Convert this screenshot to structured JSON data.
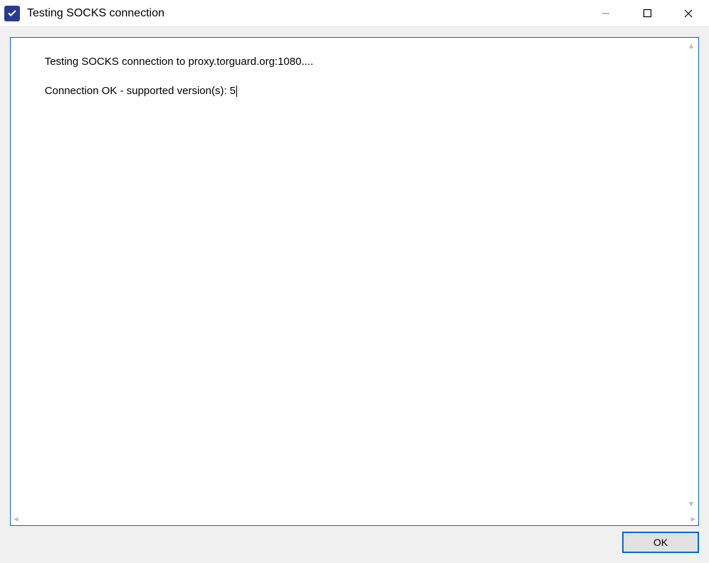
{
  "titlebar": {
    "title": "Testing SOCKS connection"
  },
  "log": {
    "lines": [
      "Testing SOCKS connection to proxy.torguard.org:1080....",
      "Connection OK - supported version(s): 5"
    ]
  },
  "buttons": {
    "ok": "OK"
  }
}
